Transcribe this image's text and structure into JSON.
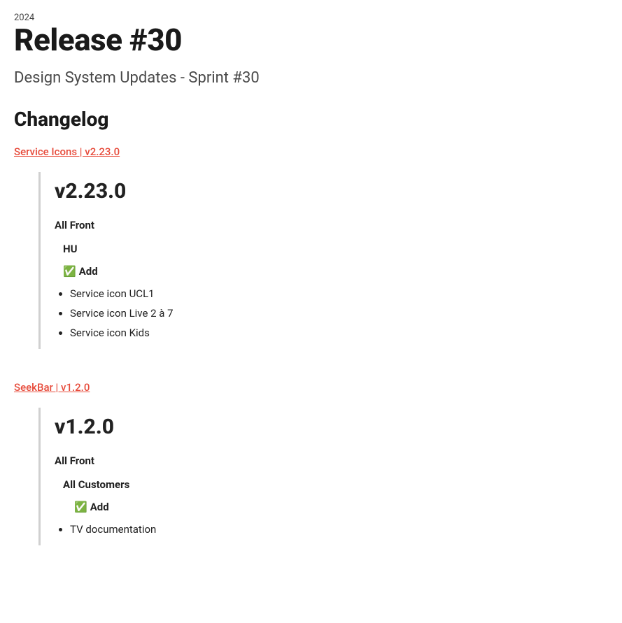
{
  "kicker": "2024",
  "title": "Release #30",
  "subtitle": "Design System Updates - Sprint #30",
  "section_heading": "Changelog",
  "action_emoji": "✅",
  "entries": [
    {
      "link_label": "Service Icons | v2.23.0",
      "version": "v2.23.0",
      "group1": "All Front",
      "group2": "HU",
      "action_label": "Add",
      "items": [
        "Service icon UCL1",
        "Service icon Live 2 à 7",
        "Service icon Kids"
      ]
    },
    {
      "link_label": "SeekBar | v1.2.0",
      "version": "v1.2.0",
      "group1": "All Front",
      "group2": "All Customers",
      "action_label": "Add",
      "items": [
        "TV documentation"
      ]
    }
  ]
}
